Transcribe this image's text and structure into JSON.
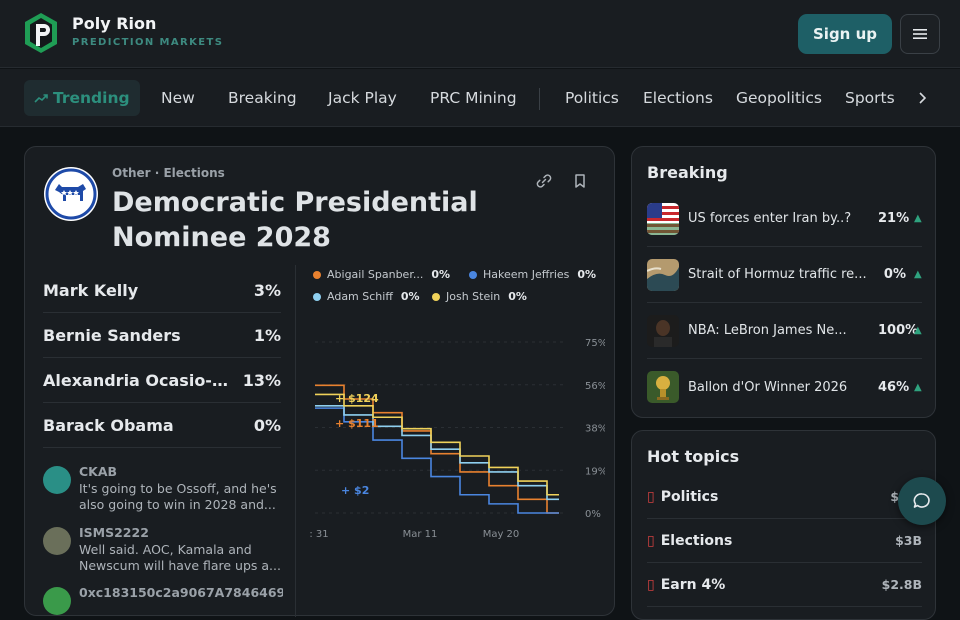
{
  "brand": {
    "name": "Poly Rion",
    "subtitle": "PREDICTION MARKETS",
    "accent": "#1f9d55"
  },
  "header": {
    "signup_label": "Sign up"
  },
  "nav": {
    "trending": "Trending",
    "items": [
      "New",
      "Breaking",
      "Jack Play",
      "PRC Mining"
    ],
    "categories": [
      "Politics",
      "Elections",
      "Geopolitics",
      "Sports"
    ]
  },
  "market": {
    "category": "Other · Elections",
    "title": "Democratic Presidential Nominee 2028",
    "candidates": [
      {
        "name": "Mark Kelly",
        "pct": "3%"
      },
      {
        "name": "Bernie Sanders",
        "pct": "1%"
      },
      {
        "name": "Alexandria Ocasio-C...",
        "pct": "13%"
      },
      {
        "name": "Barack Obama",
        "pct": "0%"
      }
    ],
    "comments": [
      {
        "user": "CKAB",
        "text": "It's going to be Ossoff, and he's also going to win in 2028 and...",
        "avatar_color": "#2a8f86"
      },
      {
        "user": "ISMS2222",
        "text": "Well said. AOC, Kamala and Newscum will have flare ups a...",
        "avatar_color": "#6a6f5a"
      },
      {
        "user": "0xc183150c2a9067A7846469",
        "text": "",
        "avatar_color": "#3a9a4a"
      }
    ]
  },
  "chart_data": {
    "type": "line",
    "x_tick_labels": [
      ": 31",
      "Mar 11",
      "May 20"
    ],
    "y_tick_labels": [
      "75%",
      "56%",
      "38%",
      "19%",
      "0%"
    ],
    "ylim": [
      0,
      75
    ],
    "legend_placement": "top",
    "series": [
      {
        "name": "Abigail Spanber...",
        "value_label": "0%",
        "color": "#e8812f",
        "values": [
          56,
          50,
          44,
          36,
          26,
          18,
          12,
          6,
          0
        ]
      },
      {
        "name": "Hakeem Jeffries",
        "value_label": "0%",
        "color": "#4a86e0",
        "values": [
          46,
          40,
          32,
          24,
          16,
          8,
          4,
          0,
          0
        ]
      },
      {
        "name": "Adam Schiff",
        "value_label": "0%",
        "color": "#8fd0f0",
        "values": [
          47,
          43,
          38,
          34,
          28,
          22,
          18,
          12,
          6
        ]
      },
      {
        "name": "Josh Stein",
        "value_label": "0%",
        "color": "#f0d25a",
        "values": [
          52,
          47,
          42,
          37,
          31,
          25,
          20,
          14,
          8
        ]
      }
    ],
    "annotations": [
      "+ $124",
      "+ $111",
      "+ $2"
    ]
  },
  "breaking": {
    "title": "Breaking",
    "items": [
      {
        "text": "US forces enter Iran by..?",
        "pct": "21%"
      },
      {
        "text": "Strait of Hormuz traffic re...",
        "pct": "0%"
      },
      {
        "text": "NBA: LeBron James Ne...",
        "pct": "100%"
      },
      {
        "text": "Ballon d'Or Winner 2026",
        "pct": "46%"
      }
    ]
  },
  "hot_topics": {
    "title": "Hot topics",
    "items": [
      {
        "label": "Politics",
        "value": "$4..."
      },
      {
        "label": "Elections",
        "value": "$3B"
      },
      {
        "label": "Earn 4%",
        "value": "$2.8B"
      }
    ]
  }
}
